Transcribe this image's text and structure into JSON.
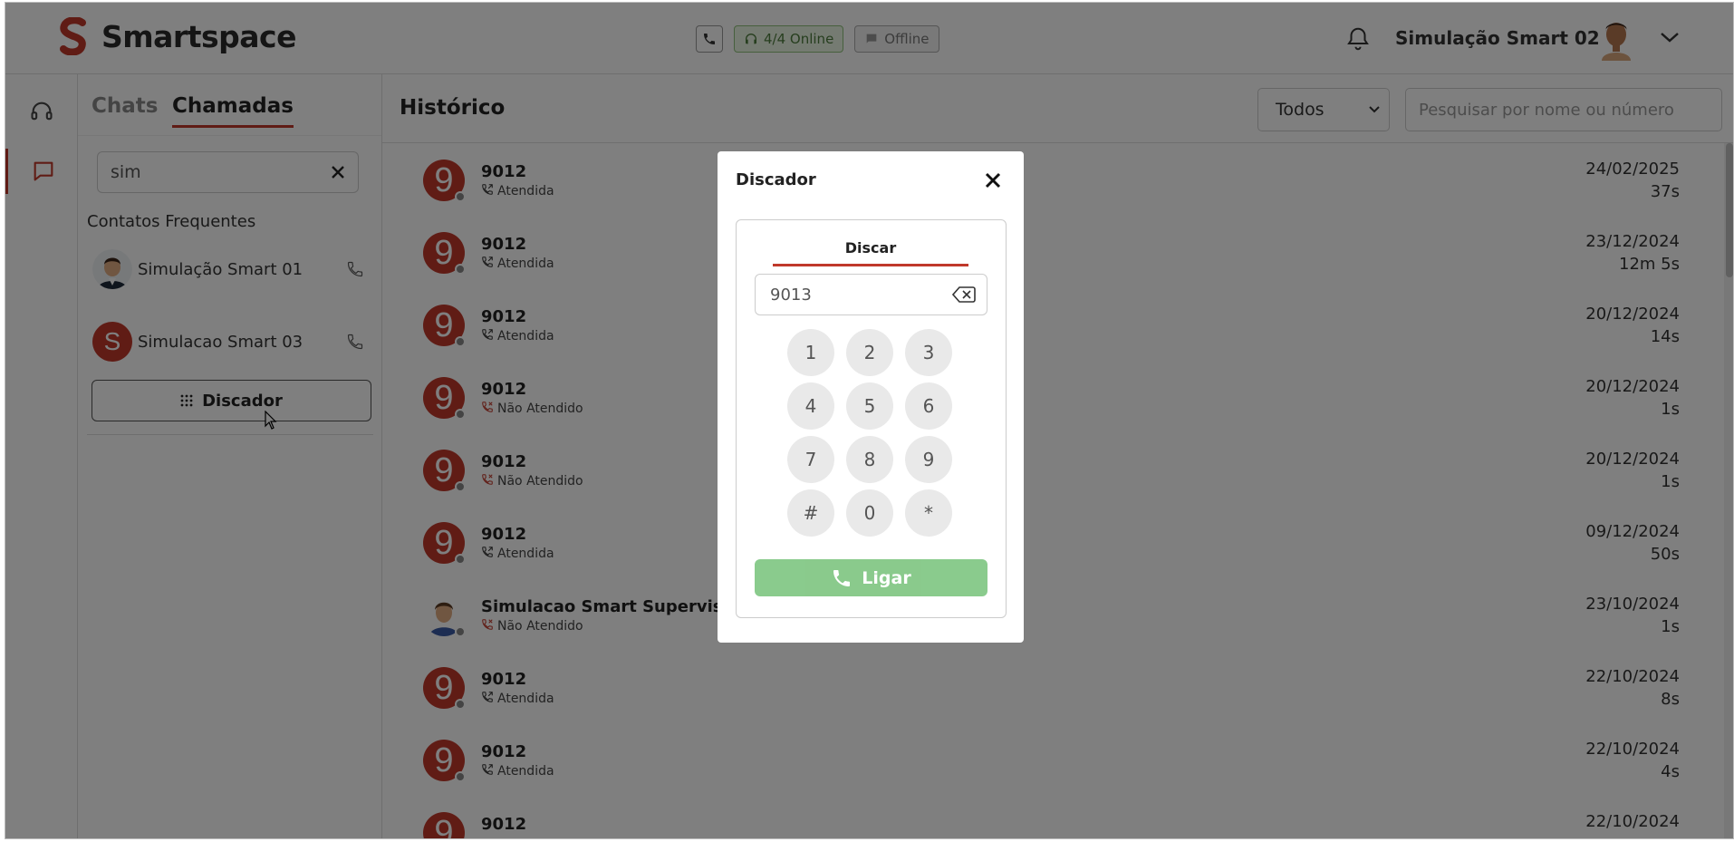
{
  "header": {
    "brand": "Smartspace",
    "online_status": "4/4 Online",
    "offline_status": "Offline",
    "user_name": "Simulação Smart 02"
  },
  "panel": {
    "tabs": [
      {
        "label": "Chats",
        "active": false
      },
      {
        "label": "Chamadas",
        "active": true
      }
    ],
    "search_value": "sim",
    "section_title": "Contatos Frequentes",
    "contacts": [
      {
        "name": "Simulação Smart 01",
        "avatar": "person"
      },
      {
        "name": "Simulacao Smart 03",
        "avatar": "S"
      }
    ],
    "dialer_button": "Discador"
  },
  "main": {
    "title": "Histórico",
    "filter_value": "Todos",
    "search_placeholder": "Pesquisar por nome ou número",
    "rows": [
      {
        "avatar": "9",
        "name": "9012",
        "status": "Atendida",
        "missed": false,
        "date": "24/02/2025",
        "duration": "37s"
      },
      {
        "avatar": "9",
        "name": "9012",
        "status": "Atendida",
        "missed": false,
        "date": "23/12/2024",
        "duration": "12m 5s"
      },
      {
        "avatar": "9",
        "name": "9012",
        "status": "Atendida",
        "missed": false,
        "date": "20/12/2024",
        "duration": "14s"
      },
      {
        "avatar": "9",
        "name": "9012",
        "status": "Não Atendido",
        "missed": true,
        "date": "20/12/2024",
        "duration": "1s"
      },
      {
        "avatar": "9",
        "name": "9012",
        "status": "Não Atendido",
        "missed": true,
        "date": "20/12/2024",
        "duration": "1s"
      },
      {
        "avatar": "9",
        "name": "9012",
        "status": "Atendida",
        "missed": false,
        "date": "09/12/2024",
        "duration": "50s"
      },
      {
        "avatar": "person",
        "name": "Simulacao Smart Supervisor",
        "status": "Não Atendido",
        "missed": true,
        "date": "23/10/2024",
        "duration": "1s"
      },
      {
        "avatar": "9",
        "name": "9012",
        "status": "Atendida",
        "missed": false,
        "date": "22/10/2024",
        "duration": "8s"
      },
      {
        "avatar": "9",
        "name": "9012",
        "status": "Atendida",
        "missed": false,
        "date": "22/10/2024",
        "duration": "4s"
      },
      {
        "avatar": "9",
        "name": "9012",
        "status": "",
        "missed": false,
        "date": "22/10/2024",
        "duration": ""
      }
    ]
  },
  "modal": {
    "title": "Discador",
    "tab_label": "Discar",
    "number_value": "9013",
    "keys": [
      "1",
      "2",
      "3",
      "4",
      "5",
      "6",
      "7",
      "8",
      "9",
      "#",
      "0",
      "*"
    ],
    "call_label": "Ligar"
  },
  "colors": {
    "brand_red": "#c0392b",
    "call_green": "#4caf50",
    "online_green": "#8fc17b"
  }
}
